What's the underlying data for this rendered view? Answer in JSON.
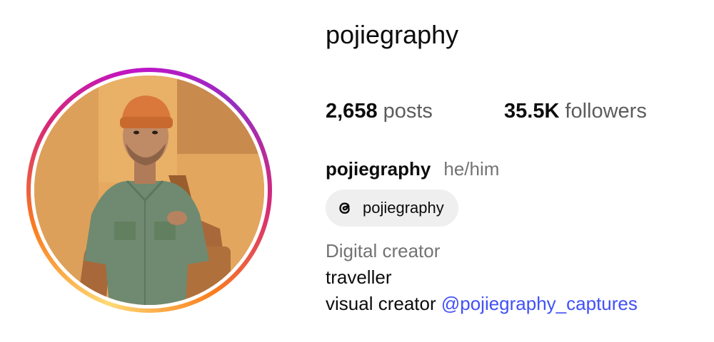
{
  "profile": {
    "username": "pojiegraphy",
    "display_name": "pojiegraphy",
    "pronouns": "he/him"
  },
  "stats": {
    "posts_count": "2,658",
    "posts_label": "posts",
    "followers_count": "35.5K",
    "followers_label": "followers"
  },
  "threads": {
    "handle": "pojiegraphy",
    "icon": "threads-icon"
  },
  "bio": {
    "category": "Digital creator",
    "line1": "traveller",
    "line2_text": "visual creator",
    "line2_mention": "@pojiegraphy_captures"
  },
  "colors": {
    "link": "#4150f7",
    "secondary_text": "#737373",
    "chip_bg": "#efefef"
  }
}
